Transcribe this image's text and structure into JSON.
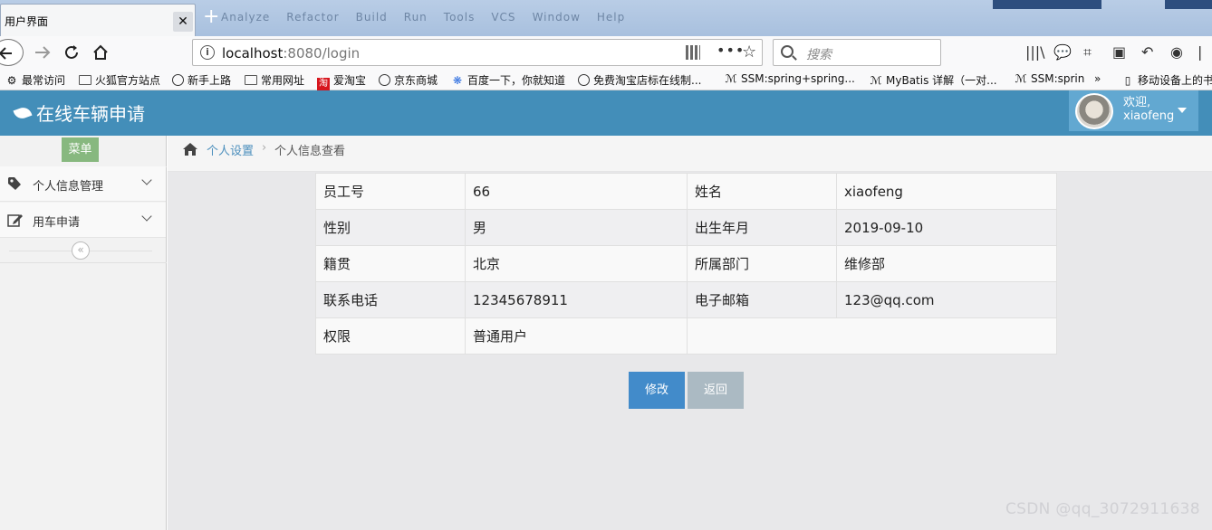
{
  "browser": {
    "tab_title": "用户界面",
    "tab_close": "✕",
    "new_tab": "+",
    "ghost_menu": [
      "Analyze",
      "Refactor",
      "Build",
      "Run",
      "Tools",
      "VCS",
      "Window",
      "Help"
    ],
    "url_host": "localhost",
    "url_rest": ":8080/login",
    "search_placeholder": "搜索",
    "bookmarks": [
      {
        "label": "最常访问",
        "icon": "gear-icon"
      },
      {
        "label": "火狐官方站点",
        "icon": "folder-icon"
      },
      {
        "label": "新手上路",
        "icon": "globe-icon"
      },
      {
        "label": "常用网址",
        "icon": "folder-icon"
      },
      {
        "label": "爱淘宝",
        "icon": "taobao-icon"
      },
      {
        "label": "京东商城",
        "icon": "globe-icon"
      },
      {
        "label": "百度一下，你就知道",
        "icon": "baidu-paw-icon"
      },
      {
        "label": "免费淘宝店标在线制...",
        "icon": "globe-icon"
      },
      {
        "label": "SSM:spring+spring...",
        "icon": "csdn-icon"
      },
      {
        "label": "MyBatis 详解（一对...",
        "icon": "csdn-icon"
      },
      {
        "label": "SSM:sprin",
        "icon": "csdn-icon"
      },
      {
        "label": "移动设备上的书签",
        "icon": "mobile-icon"
      }
    ]
  },
  "app": {
    "brand": "在线车辆申请",
    "user": {
      "greeting": "欢迎,",
      "name": "xiaofeng"
    }
  },
  "sidebar": {
    "menu_label": "菜单",
    "items": [
      {
        "label": "个人信息管理",
        "icon": "tag-icon"
      },
      {
        "label": "用车申请",
        "icon": "edit-icon"
      }
    ],
    "collapse_symbol": "«"
  },
  "breadcrumb": {
    "parent": "个人设置",
    "separator": "›",
    "current": "个人信息查看"
  },
  "profile": {
    "rows": [
      {
        "k1": "员工号",
        "v1": "66",
        "k2": "姓名",
        "v2": "xiaofeng"
      },
      {
        "k1": "性别",
        "v1": "男",
        "k2": "出生年月",
        "v2": "2019-09-10"
      },
      {
        "k1": "籍贯",
        "v1": "北京",
        "k2": "所属部门",
        "v2": "维修部"
      },
      {
        "k1": "联系电话",
        "v1": "12345678911",
        "k2": "电子邮箱",
        "v2": "123@qq.com"
      },
      {
        "k1": "权限",
        "v1": "普通用户",
        "k2": "",
        "v2": ""
      }
    ],
    "edit_label": "修改",
    "back_label": "返回"
  },
  "watermark": "CSDN @qq_3072911638",
  "colors": {
    "header_bg": "#438eb9",
    "user_menu_bg": "#62a8d1",
    "menu_btn_bg": "#87b87f",
    "edit_btn_bg": "#428bca",
    "back_btn_bg": "#abbac3"
  }
}
